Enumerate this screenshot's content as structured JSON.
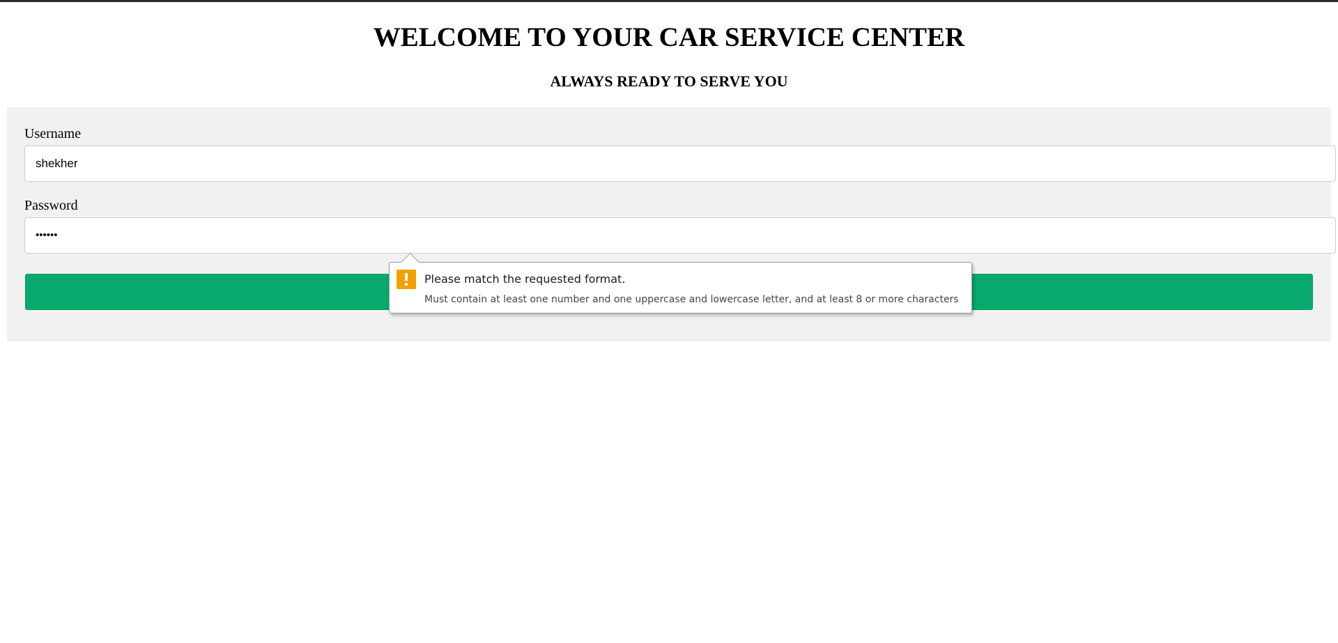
{
  "page": {
    "title": "WELCOME TO YOUR CAR SERVICE CENTER",
    "subtitle": "ALWAYS READY TO SERVE YOU"
  },
  "form": {
    "username_label": "Username",
    "username_value": "shekher",
    "password_label": "Password",
    "password_display": "••••••",
    "submit_label": "",
    "submit_color": "#07aa6c",
    "panel_color": "#f1f1f1"
  },
  "tooltip": {
    "icon": "warning-icon",
    "icon_color": "#f4a100",
    "title": "Please match the requested format.",
    "detail": "Must contain at least one number and one uppercase and lowercase letter, and at least 8 or more characters"
  }
}
